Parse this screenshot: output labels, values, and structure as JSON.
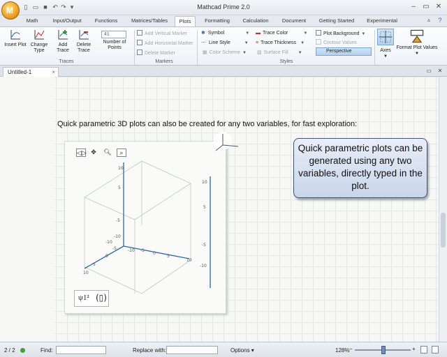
{
  "app": {
    "title": "Mathcad Prime 2.0",
    "logo_letter": "M"
  },
  "tabs": [
    {
      "label": "Math"
    },
    {
      "label": "Input/Output"
    },
    {
      "label": "Functions"
    },
    {
      "label": "Matrices/Tables"
    },
    {
      "label": "Plots"
    },
    {
      "label": "Formatting"
    },
    {
      "label": "Calculation"
    },
    {
      "label": "Document"
    },
    {
      "label": "Getting Started"
    },
    {
      "label": "Experimental"
    }
  ],
  "ribbon": {
    "traces": {
      "insert_plot": "Insert Plot",
      "change_type": "Change Type",
      "add_trace": "Add Trace",
      "delete_trace": "Delete Trace",
      "num_points_value": "41",
      "num_points_label": "Number of Points",
      "group_label": "Traces"
    },
    "markers": {
      "add_vertical": "Add Vertical Marker",
      "add_horizontal": "Add Horizontal Marker",
      "delete": "Delete Marker",
      "group_label": "Markers"
    },
    "styles": {
      "symbol": "Symbol",
      "line_style": "Line Style",
      "color_scheme": "Color Scheme",
      "trace_color": "Trace Color",
      "trace_thickness": "Trace Thickness",
      "surface_fill": "Surface Fill",
      "plot_background": "Plot Background",
      "contour_values": "Contour Values",
      "perspective": "Perspective",
      "group_label": "Styles"
    },
    "axes": "Axes",
    "format_plot_values": "Format Plot Values"
  },
  "document": {
    "tab_label": "Untitled-1"
  },
  "worksheet": {
    "caption": "Quick parametric 3D plots can also be created for any two variables, for fast exploration:",
    "callout": "Quick parametric plots can be generated using any two variables, directly typed in the plot.",
    "function_expr": "ψ1²",
    "axis_ticks": {
      "z": [
        "10",
        "5",
        "-5",
        "-10"
      ],
      "y_right": [
        "10",
        "5",
        "-5",
        "-10"
      ],
      "x_front": [
        "10",
        "5",
        "0",
        "-5",
        "-10"
      ],
      "y_back": [
        "10",
        "5",
        "0",
        "-5",
        "-10"
      ]
    }
  },
  "status": {
    "page": "2 / 2",
    "find_label": "Find:",
    "find_value": "",
    "replace_label": "Replace with:",
    "replace_value": "",
    "options": "Options",
    "zoom": "128%"
  }
}
